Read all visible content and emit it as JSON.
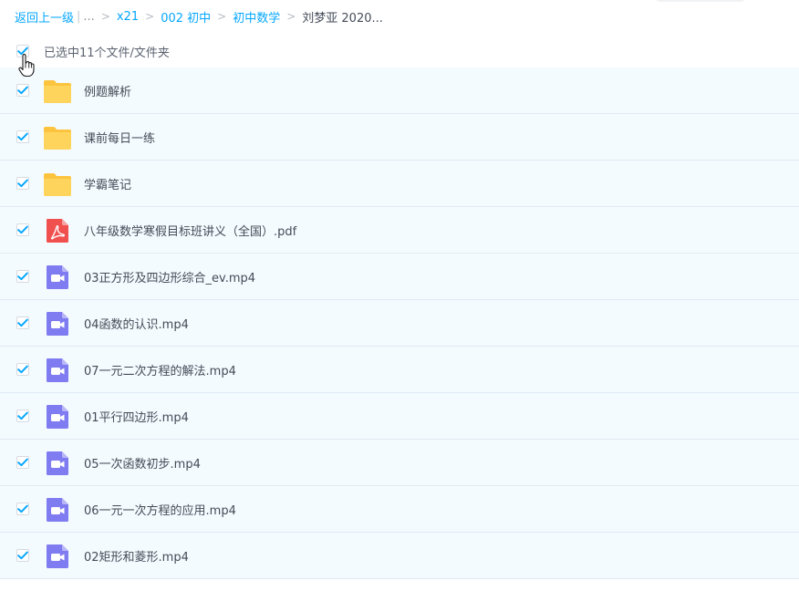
{
  "breadcrumb": {
    "back": "返回上一级",
    "separator": "|",
    "ellipsis": "...",
    "items": [
      "x21",
      "002 初中",
      "初中数学"
    ],
    "current": "刘梦亚 2020..."
  },
  "selection": {
    "text": "已选中11个文件/文件夹",
    "checked": true
  },
  "colors": {
    "accent": "#06a7ff",
    "folder": "#ffcc4d",
    "pdf": "#f0514f",
    "video": "#7f7bf0",
    "row_bg": "#f4fbff"
  },
  "files": [
    {
      "name": "例题解析",
      "type": "folder",
      "icon": "folder-icon"
    },
    {
      "name": "课前每日一练",
      "type": "folder",
      "icon": "folder-icon"
    },
    {
      "name": "学霸笔记",
      "type": "folder",
      "icon": "folder-icon"
    },
    {
      "name": "八年级数学寒假目标班讲义（全国）.pdf",
      "type": "pdf",
      "icon": "pdf-icon"
    },
    {
      "name": "03正方形及四边形综合_ev.mp4",
      "type": "video",
      "icon": "video-icon"
    },
    {
      "name": "04函数的认识.mp4",
      "type": "video",
      "icon": "video-icon"
    },
    {
      "name": "07一元二次方程的解法.mp4",
      "type": "video",
      "icon": "video-icon"
    },
    {
      "name": "01平行四边形.mp4",
      "type": "video",
      "icon": "video-icon"
    },
    {
      "name": "05一次函数初步.mp4",
      "type": "video",
      "icon": "video-icon"
    },
    {
      "name": "06一元一次方程的应用.mp4",
      "type": "video",
      "icon": "video-icon"
    },
    {
      "name": "02矩形和菱形.mp4",
      "type": "video",
      "icon": "video-icon"
    }
  ]
}
